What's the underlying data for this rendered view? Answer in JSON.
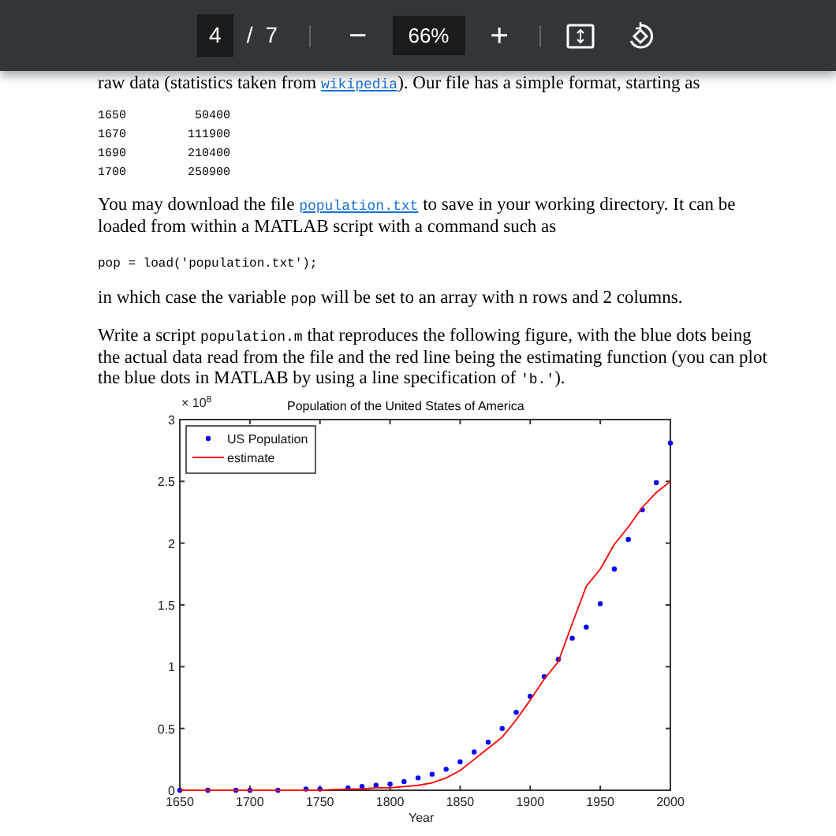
{
  "toolbar": {
    "page_current": "4",
    "page_separator": "/",
    "page_total": "7",
    "zoom_out": "−",
    "zoom": "66%",
    "zoom_in": "+"
  },
  "document": {
    "intro": [
      {
        "kind": "text",
        "text": "raw data (statistics taken from "
      },
      {
        "kind": "link",
        "text": "wikipedia"
      },
      {
        "kind": "text",
        "text": "). Our file has a simple format, starting as"
      }
    ],
    "data_rows": [
      [
        "1650",
        "50400"
      ],
      [
        "1670",
        "111900"
      ],
      [
        "1690",
        "210400"
      ],
      [
        "1700",
        "250900"
      ]
    ],
    "paragraph_1": [
      {
        "kind": "text",
        "text": "You may download the file "
      },
      {
        "kind": "link",
        "text": "population.txt"
      },
      {
        "kind": "text",
        "text": " to save in your working directory. It can be loaded from within a MATLAB script with a command such as"
      }
    ],
    "code_line": "pop = load('population.txt');",
    "paragraph_2": [
      {
        "kind": "text",
        "text": "in which case the variable "
      },
      {
        "kind": "code",
        "text": "pop"
      },
      {
        "kind": "text",
        "text": " will be set to an array with n rows and 2 columns."
      }
    ],
    "paragraph_3": [
      {
        "kind": "text",
        "text": "Write a script "
      },
      {
        "kind": "code",
        "text": "population.m"
      },
      {
        "kind": "text",
        "text": " that reproduces the following figure, with the blue dots being the actual data read from the file and the red line being the estimating function (you can plot the blue dots in MATLAB by using a line specification of "
      },
      {
        "kind": "code",
        "text": "'b.'"
      },
      {
        "kind": "text",
        "text": ")."
      }
    ],
    "figure": {
      "exponent_label": "× 10$^{8}$",
      "chart_data": {
        "type": "line",
        "title": "Population of the United States of America",
        "xlabel": "Year",
        "x": [
          1650,
          1670,
          1690,
          1700,
          1720,
          1740,
          1750,
          1770,
          1780,
          1790,
          1800,
          1810,
          1820,
          1830,
          1840,
          1850,
          1860,
          1870,
          1880,
          1890,
          1900,
          1910,
          1920,
          1930,
          1940,
          1950,
          1960,
          1970,
          1980,
          1990,
          2000
        ],
        "series": [
          {
            "name": "US Population",
            "type": "scatter",
            "color": "#0000ff",
            "values": [
              0,
              0,
              0,
              0,
              0,
              0.01,
              0.01,
              0.02,
              0.03,
              0.04,
              0.05,
              0.07,
              0.1,
              0.13,
              0.17,
              0.23,
              0.31,
              0.39,
              0.5,
              0.63,
              0.76,
              0.92,
              1.06,
              1.23,
              1.32,
              1.51,
              1.79,
              2.03,
              2.27,
              2.49,
              2.81
            ]
          },
          {
            "name": "estimate",
            "type": "line",
            "color": "#ff0000",
            "values": [
              0,
              0,
              0,
              0,
              0,
              0,
              0,
              0.01,
              0.01,
              0.02,
              0.02,
              0.03,
              0.04,
              0.06,
              0.1,
              0.16,
              0.25,
              0.34,
              0.43,
              0.57,
              0.73,
              0.9,
              1.04,
              1.35,
              1.65,
              1.79,
              1.99,
              2.13,
              2.29,
              2.41,
              2.5
            ]
          }
        ],
        "legend": true,
        "xlim": [
          1650,
          2000
        ],
        "ylim": [
          0,
          3
        ],
        "xticks": [
          1650,
          1700,
          1750,
          1800,
          1850,
          1900,
          1950,
          2000
        ],
        "yticks": [
          {
            "value": 0,
            "label": "0"
          },
          {
            "value": 0.5,
            "label": "0.5"
          },
          {
            "value": 1,
            "label": "1"
          },
          {
            "value": 1.5,
            "label": "1.5"
          },
          {
            "value": 2,
            "label": "2"
          },
          {
            "value": 2.5,
            "label": "2.5"
          },
          {
            "value": 3,
            "label": "3"
          }
        ]
      }
    }
  }
}
